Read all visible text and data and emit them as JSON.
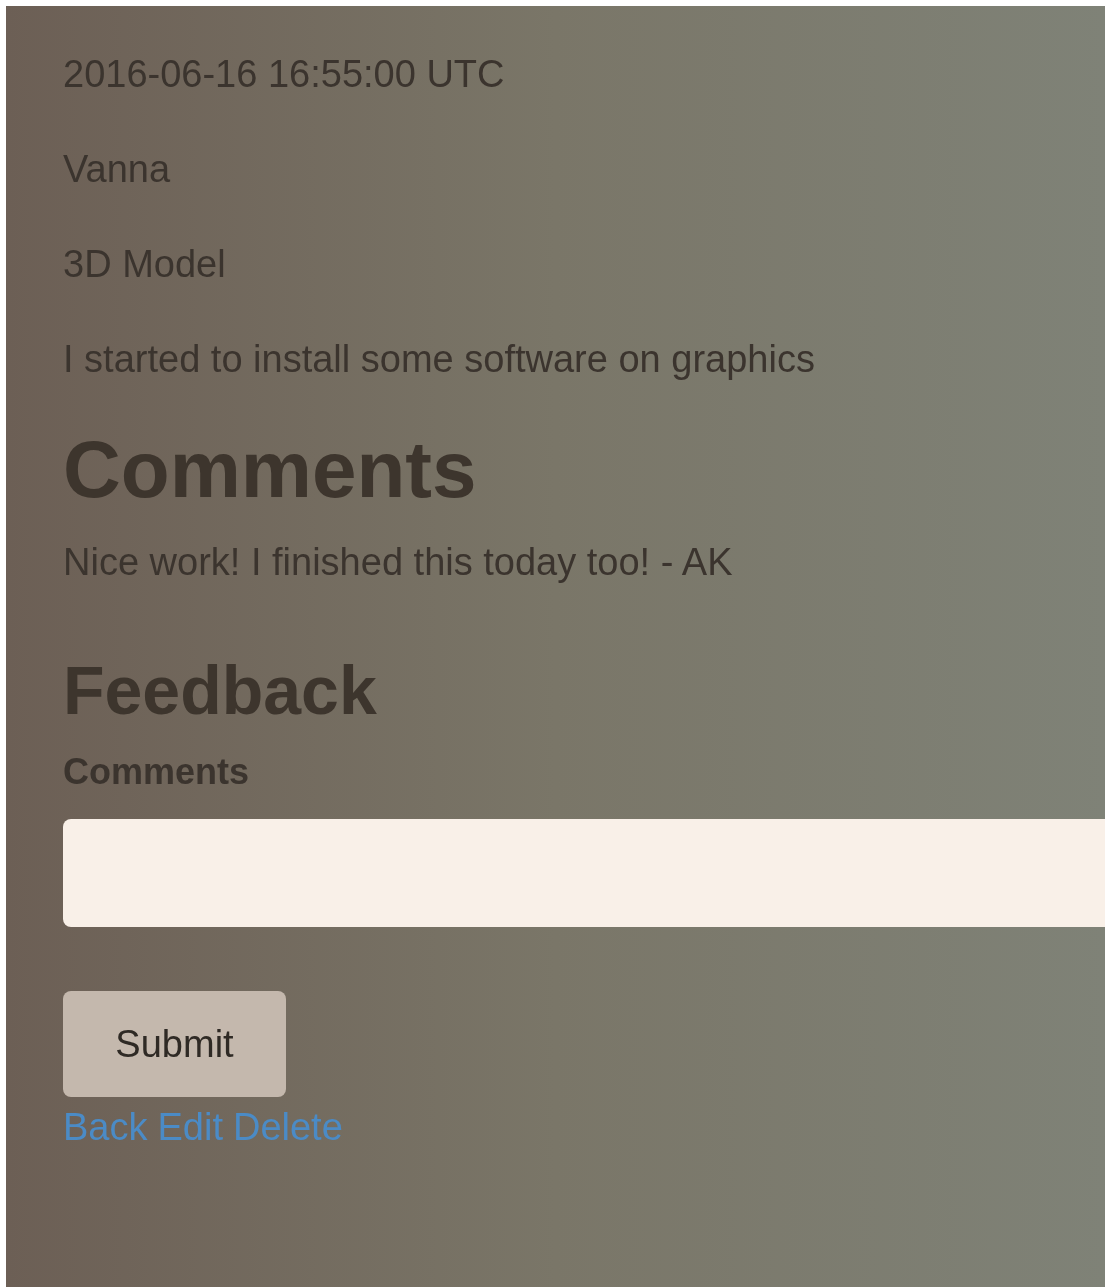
{
  "details": [
    "2016-06-16 16:55:00 UTC",
    "Vanna",
    "3D Model",
    "I started to install some software on graphics"
  ],
  "comments_heading": "Comments",
  "comments": [
    "Nice work! I finished this today too! - AK"
  ],
  "feedback": {
    "heading": "Feedback",
    "label": "Comments",
    "submit": "Submit"
  },
  "links": [
    "Back",
    "Edit",
    "Delete"
  ]
}
